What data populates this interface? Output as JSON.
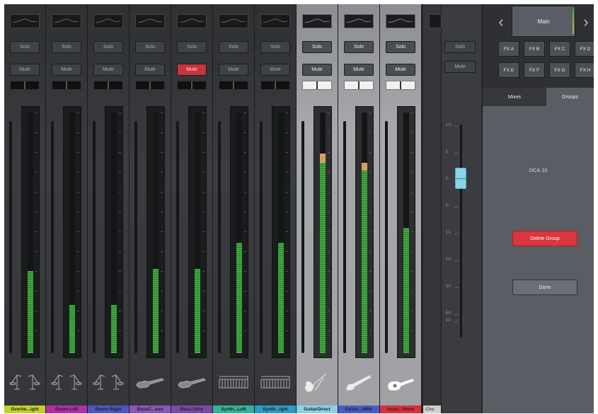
{
  "channels": [
    {
      "name": "Overhe...ight",
      "color": "#c4cf2e",
      "solo": "Solo",
      "mute": "Mute",
      "mute_active": false,
      "lit": false,
      "level": 0.34,
      "peak": 0,
      "icon": "drum-overhead-icon"
    },
    {
      "name": "Room Left",
      "color": "#b22fa8",
      "solo": "Solo",
      "mute": "Mute",
      "mute_active": false,
      "lit": false,
      "level": 0.2,
      "peak": 0,
      "icon": "drum-overhead-icon"
    },
    {
      "name": "Room Right",
      "color": "#4e56c0",
      "solo": "Solo",
      "mute": "Mute",
      "mute_active": false,
      "lit": false,
      "level": 0.2,
      "peak": 0,
      "icon": "drum-overhead-icon"
    },
    {
      "name": "BassC...ean",
      "color": "#8a56b8",
      "solo": "Solo",
      "mute": "Mute",
      "mute_active": false,
      "lit": false,
      "level": 0.35,
      "peak": 0,
      "icon": "bass-guitar-icon"
    },
    {
      "name": "Bass Dirty",
      "color": "#7a4aa8",
      "solo": "Solo",
      "mute": "Mute",
      "mute_active": true,
      "lit": false,
      "level": 0.35,
      "peak": 0,
      "icon": "bass-guitar-icon"
    },
    {
      "name": "Synth...Left",
      "color": "#33b39a",
      "solo": "Solo",
      "mute": "Mute",
      "mute_active": false,
      "lit": false,
      "level": 0.46,
      "peak": 0,
      "icon": "keyboard-icon"
    },
    {
      "name": "Synth...ight",
      "color": "#2f9ac8",
      "solo": "Solo",
      "mute": "Mute",
      "mute_active": false,
      "lit": false,
      "level": 0.46,
      "peak": 0,
      "icon": "keyboard-icon"
    },
    {
      "name": "GuitarDirect",
      "color": "#8ad1e6",
      "solo": "Solo",
      "mute": "Mute",
      "mute_active": false,
      "lit": true,
      "level": 0.79,
      "peak": 0.04,
      "icon": "acoustic-guitar-icon"
    },
    {
      "name": "Guitar...bMic",
      "color": "#4a5ac8",
      "solo": "Solo",
      "mute": "Mute",
      "mute_active": false,
      "lit": true,
      "level": 0.76,
      "peak": 0.03,
      "icon": "electric-guitar-icon"
    },
    {
      "name": "Acou...Voice",
      "color": "#d8303a",
      "solo": "Solo",
      "mute": "Mute",
      "mute_active": false,
      "lit": true,
      "level": 0.52,
      "peak": 0,
      "icon": "acoustic-electric-guitar-icon"
    }
  ],
  "partial_channel": {
    "name": "Cho",
    "color": "#cfcfcf"
  },
  "master": {
    "solo": "Solo",
    "mute": "Mute",
    "fader_value_db": 0,
    "scale": [
      "10-",
      "5-",
      "0-",
      "5-",
      "10-",
      "20-",
      "30-",
      "60-",
      "00-"
    ]
  },
  "right_panel": {
    "main_label": "Main",
    "fx_buttons": [
      "FX A",
      "FX B",
      "FX C",
      "FX D",
      "FX E",
      "FX F",
      "FX G",
      "FX H"
    ],
    "tabs": {
      "mixes": "Mixes",
      "groups": "Groups"
    },
    "group_name": "DCA 10",
    "delete_label": "Delete Group",
    "done_label": "Done"
  },
  "colors": {
    "mute_active": "#c8343b",
    "fader_handle": "#8ad4e8",
    "delete": "#d9363e"
  }
}
